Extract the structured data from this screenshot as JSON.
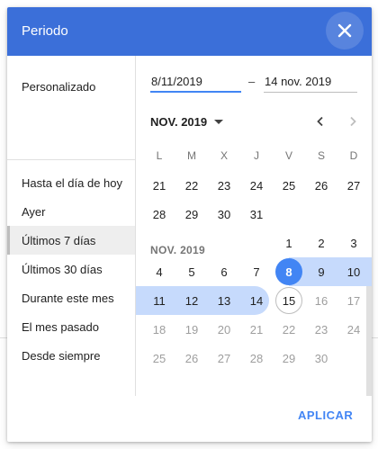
{
  "dialog": {
    "title": "Periodo",
    "close_icon": "close-icon",
    "apply_label": "APLICAR"
  },
  "presets": [
    {
      "label": "Personalizado"
    },
    {
      "label": "Hasta el día de hoy"
    },
    {
      "label": "Ayer"
    },
    {
      "label": "Últimos 7 días"
    },
    {
      "label": "Últimos 30 días"
    },
    {
      "label": "Durante este mes"
    },
    {
      "label": "El mes pasado"
    },
    {
      "label": "Desde siempre"
    }
  ],
  "selected_preset": "Últimos 7 días",
  "range": {
    "start_value": "8/11/2019",
    "separator": "–",
    "end_value": "14 nov. 2019"
  },
  "calendar": {
    "month_selector": "NOV. 2019",
    "month_label": "NOV. 2019",
    "prev_icon": "chevron-left-icon",
    "next_icon": "chevron-right-icon",
    "weekdays": [
      "L",
      "M",
      "X",
      "J",
      "V",
      "S",
      "D"
    ],
    "prev_month_week1": [
      "21",
      "22",
      "23",
      "24",
      "25",
      "26",
      "27"
    ],
    "prev_month_week2": [
      "28",
      "29",
      "30",
      "31"
    ],
    "nov_week1": [
      "1",
      "2",
      "3"
    ],
    "nov_week2": [
      "4",
      "5",
      "6",
      "7",
      "8",
      "9",
      "10"
    ],
    "nov_week3": [
      "11",
      "12",
      "13",
      "14",
      "15",
      "16",
      "17"
    ],
    "nov_week4": [
      "18",
      "19",
      "20",
      "21",
      "22",
      "23",
      "24"
    ],
    "nov_week5": [
      "25",
      "26",
      "27",
      "28",
      "29",
      "30"
    ],
    "selected_start_day": "8",
    "selected_end_day": "14",
    "today_day": "15"
  },
  "colors": {
    "header": "#3b6fd9",
    "accent": "#4285f4",
    "range": "#c6dafc"
  }
}
